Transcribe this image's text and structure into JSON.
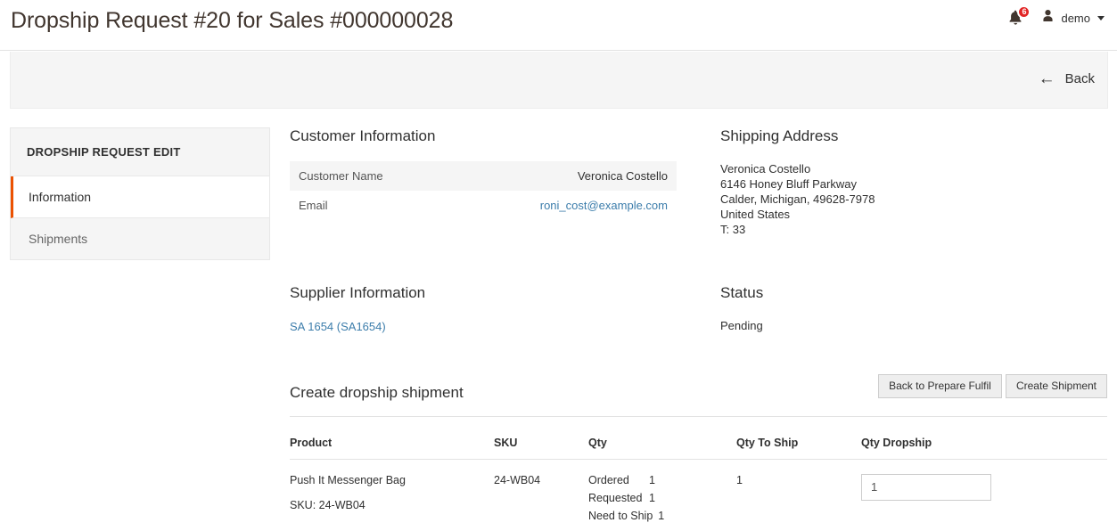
{
  "header": {
    "title": "Dropship Request #20 for Sales #000000028",
    "notifications_count": "6",
    "user_name": "demo"
  },
  "toolbar": {
    "back_label": "Back",
    "back_arrow": "←"
  },
  "sidebar": {
    "title": "DROPSHIP REQUEST EDIT",
    "items": [
      {
        "label": "Information",
        "active": true
      },
      {
        "label": "Shipments",
        "active": false
      }
    ]
  },
  "customer_information": {
    "title": "Customer Information",
    "rows": [
      {
        "label": "Customer Name",
        "value": "Veronica Costello",
        "is_link": false
      },
      {
        "label": "Email",
        "value": "roni_cost@example.com",
        "is_link": true
      }
    ]
  },
  "shipping_address": {
    "title": "Shipping Address",
    "lines": [
      "Veronica Costello",
      "6146 Honey Bluff Parkway",
      "Calder, Michigan, 49628-7978",
      "United States",
      "T: 33"
    ]
  },
  "supplier_information": {
    "title": "Supplier Information",
    "supplier_link": "SA 1654 (SA1654)"
  },
  "status": {
    "title": "Status",
    "value": "Pending"
  },
  "shipment": {
    "title": "Create dropship shipment",
    "buttons": {
      "back_to_prepare": "Back to Prepare Fulfil",
      "create_shipment": "Create Shipment"
    },
    "columns": {
      "product": "Product",
      "sku": "SKU",
      "qty": "Qty",
      "qty_to_ship": "Qty To Ship",
      "qty_dropship": "Qty Dropship"
    },
    "rows": [
      {
        "product_name": "Push It Messenger Bag",
        "product_sku_label": "SKU: 24-WB04",
        "sku": "24-WB04",
        "qty": [
          {
            "label": "Ordered",
            "value": "1"
          },
          {
            "label": "Requested",
            "value": "1"
          },
          {
            "label": "Need to Ship",
            "value": "1"
          }
        ],
        "qty_to_ship": "1",
        "qty_dropship": "1"
      }
    ]
  },
  "colors": {
    "accent_orange": "#eb5202",
    "link_blue": "#3c7dab",
    "badge_red": "#e22626",
    "panel_gray": "#f5f5f5"
  }
}
